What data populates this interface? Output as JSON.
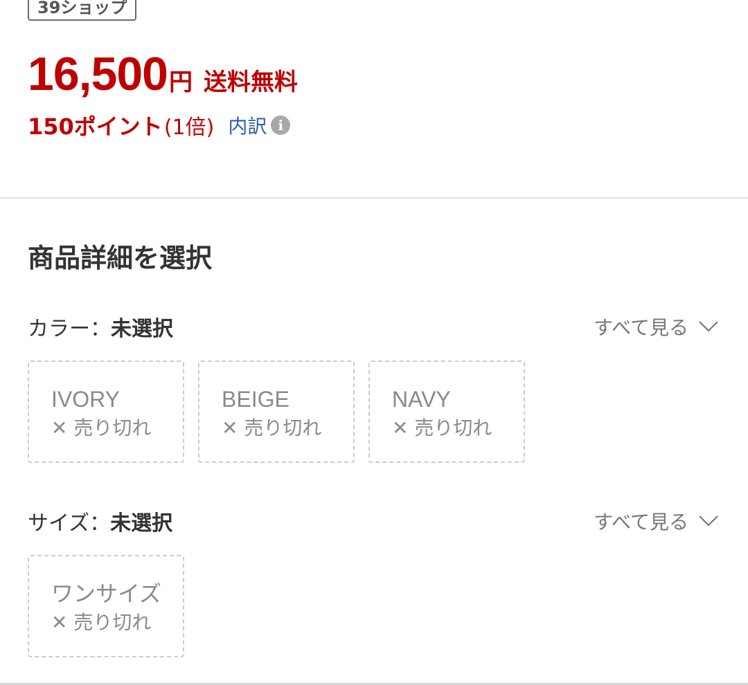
{
  "shop": {
    "badge": "39ショップ"
  },
  "price": {
    "amount": "16,500",
    "currency": "円",
    "shipping": "送料無料"
  },
  "points": {
    "text": "150ポイント",
    "multiplier": "(1倍)",
    "breakdown_link": "内訳",
    "info_icon": "info-icon"
  },
  "selection": {
    "title": "商品詳細を選択",
    "see_all": "すべて見る",
    "color": {
      "label": "カラー：",
      "value": "未選択",
      "options": [
        {
          "name": "IVORY",
          "status": "✕ 売り切れ"
        },
        {
          "name": "BEIGE",
          "status": "✕ 売り切れ"
        },
        {
          "name": "NAVY",
          "status": "✕ 売り切れ"
        }
      ]
    },
    "size": {
      "label": "サイズ：",
      "value": "未選択",
      "options": [
        {
          "name": "ワンサイズ",
          "status": "✕ 売り切れ"
        }
      ]
    }
  },
  "colors": {
    "price_red": "#bf0000",
    "link_blue": "#2b5ea7",
    "muted_gray": "#8a8a8a"
  }
}
